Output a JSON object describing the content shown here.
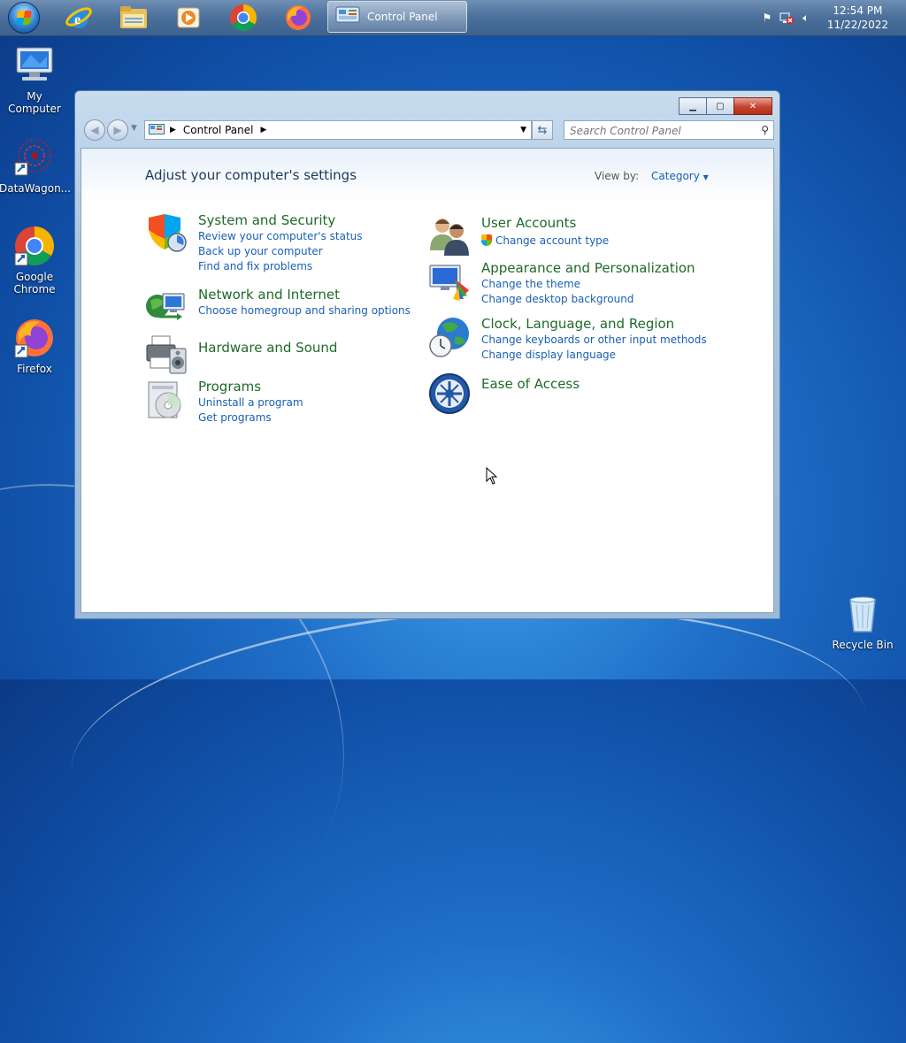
{
  "taskbar": {
    "pinned": [
      {
        "name": "internet-explorer-icon"
      },
      {
        "name": "file-explorer-icon"
      },
      {
        "name": "media-player-icon"
      },
      {
        "name": "chrome-icon"
      },
      {
        "name": "firefox-icon"
      }
    ],
    "active_window_label": "Control Panel",
    "clock_time": "12:54 PM",
    "clock_date": "11/22/2022"
  },
  "desktop_icons": [
    {
      "label": "My Computer",
      "icon": "computer-icon"
    },
    {
      "label": "DataWagon...",
      "icon": "datawagon-icon"
    },
    {
      "label": "Google Chrome",
      "icon": "chrome-icon"
    },
    {
      "label": "Firefox",
      "icon": "firefox-icon"
    },
    {
      "label": "Recycle Bin",
      "icon": "recycle-bin-icon"
    }
  ],
  "window": {
    "address_path": "Control Panel",
    "search_placeholder": "Search Control Panel",
    "heading": "Adjust your computer's settings",
    "view_by_label": "View by:",
    "view_by_value": "Category",
    "categories": [
      {
        "title": "System and Security",
        "links": [
          "Review your computer's status",
          "Back up your computer",
          "Find and fix problems"
        ]
      },
      {
        "title": "Network and Internet",
        "links": [
          "Choose homegroup and sharing options"
        ]
      },
      {
        "title": "Hardware and Sound",
        "links": []
      },
      {
        "title": "Programs",
        "links": [
          "Uninstall a program",
          "Get programs"
        ]
      },
      {
        "title": "User Accounts",
        "links": [
          "Change account type"
        ]
      },
      {
        "title": "Appearance and Personalization",
        "links": [
          "Change the theme",
          "Change desktop background"
        ]
      },
      {
        "title": "Clock, Language, and Region",
        "links": [
          "Change keyboards or other input methods",
          "Change display language"
        ]
      },
      {
        "title": "Ease of Access",
        "links": []
      }
    ]
  },
  "colors": {
    "category_title": "#1e6a2a",
    "link": "#1a5fb4",
    "desktop": "#1f6fc8"
  }
}
